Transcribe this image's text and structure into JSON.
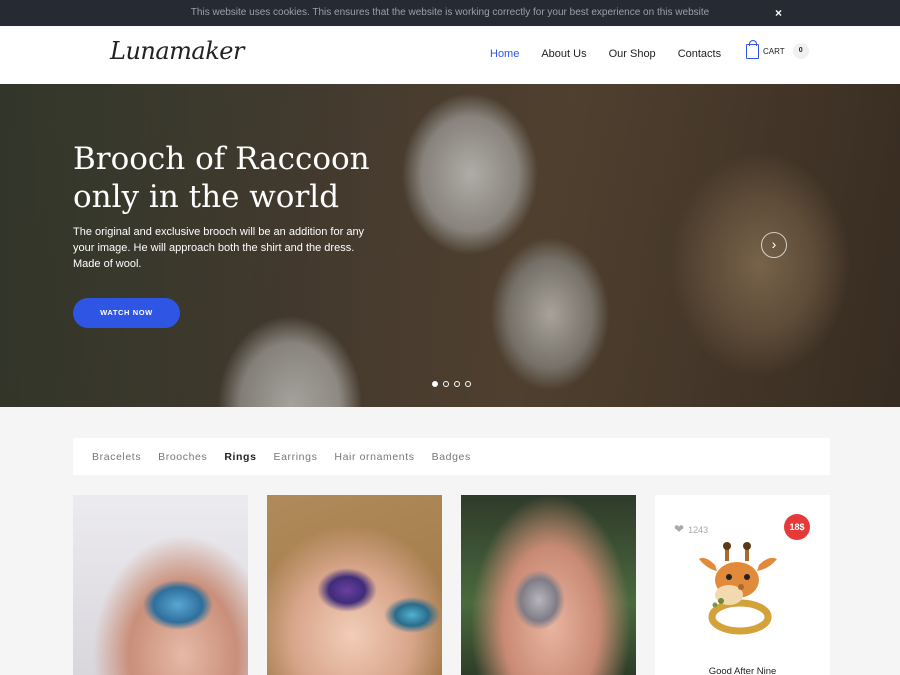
{
  "cookie": {
    "message": "This website uses cookies. This ensures that the website is working correctly for your best experience on this website",
    "close_label": "×"
  },
  "header": {
    "logo": "Lunamaker",
    "nav": [
      "Home",
      "About Us",
      "Our Shop",
      "Contacts"
    ],
    "active_nav": "Home",
    "cart_label": "CART",
    "cart_count": "0"
  },
  "hero": {
    "title": "Brooch of Raccoon only in the world",
    "description": "The original and exclusive brooch will be an addition for any your image. He will approach both the shirt and the dress. Made of wool.",
    "button_label": "WATCH NOW",
    "slides_total": 4,
    "active_slide": 1
  },
  "categories": {
    "items": [
      "Bracelets",
      "Brooches",
      "Rings",
      "Earrings",
      "Hair ornaments",
      "Badges"
    ],
    "active": "Rings"
  },
  "products": [
    {
      "image": "blue-enamel-ring"
    },
    {
      "image": "purple-flower-ring"
    },
    {
      "image": "amethyst-crystal-ring"
    },
    {
      "image": "giraffe-ring",
      "likes": "1243",
      "price": "18$",
      "name": "Good After Nine"
    }
  ],
  "colors": {
    "accent": "#2f55e4",
    "cookie_bg": "#262b33",
    "price_badge": "#e63a3a"
  }
}
